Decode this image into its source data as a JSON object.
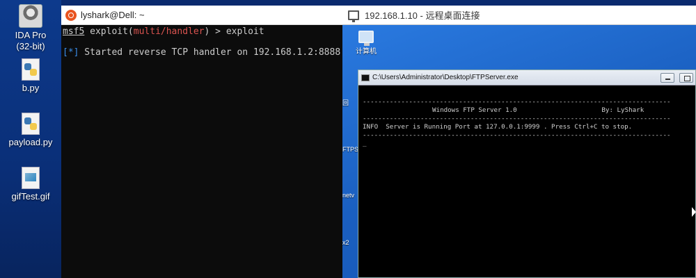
{
  "host_desktop": {
    "icons": [
      {
        "label_line1": "IDA Pro",
        "label_line2": "(32-bit)",
        "icon": "ida-avatar-icon"
      },
      {
        "label_line1": "b.py",
        "label_line2": "",
        "icon": "python-file-icon"
      },
      {
        "label_line1": "payload.py",
        "label_line2": "",
        "icon": "python-file-icon"
      },
      {
        "label_line1": "gifTest.gif",
        "label_line2": "",
        "icon": "gif-file-icon"
      }
    ]
  },
  "terminal": {
    "title": "lyshark@Dell: ~",
    "prompt": {
      "label": "msf5",
      "cmd_prefix": " exploit(",
      "module": "multi/handler",
      "cmd_suffix": ") > exploit"
    },
    "output": {
      "marker": "[*]",
      "text": " Started reverse TCP handler on 192.168.1.2:8888"
    }
  },
  "rdp": {
    "title": "192.168.1.10 - 远程桌面连接",
    "desktop_icon_label": "计算机",
    "side_labels": [
      "回",
      "FTPS",
      "netv",
      "x2"
    ],
    "console": {
      "title": "C:\\Users\\Administrator\\Desktop\\FTPServer.exe",
      "divider": "--------------------------------------------------------------------------------",
      "banner": "Windows FTP Server 1.0                      By: LyShark",
      "info_line": "INFO  Server is Running Port at 127.0.0.1:9999 . Press Ctrl+C to stop.",
      "cursor": "_"
    }
  },
  "colors": {
    "terminal_bg": "#0c0c0c",
    "module_red": "#d9534f",
    "marker_blue": "#3b8eea",
    "rdp_desktop_blue": "#1a64c8"
  }
}
